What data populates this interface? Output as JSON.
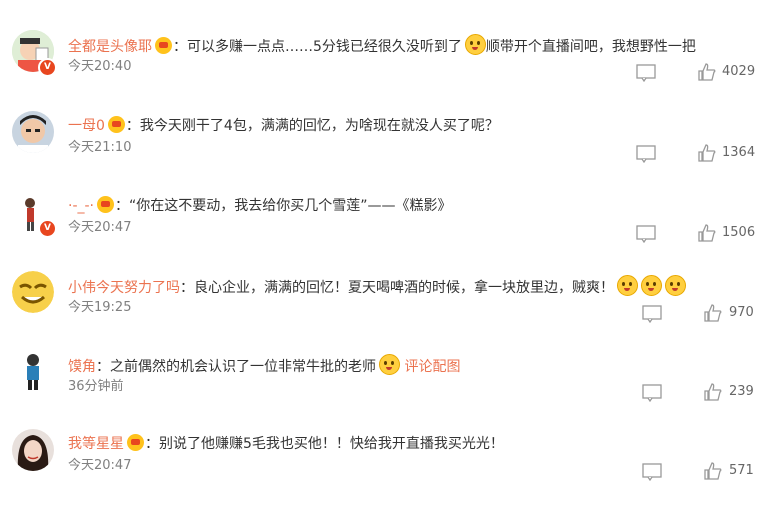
{
  "comments": [
    {
      "user": "全都是头像耶",
      "text": "：可以多赚一点点……5分钱已经很久没听到了",
      "text2": "顺带开个直播间吧，我想野性一把",
      "time": "今天20:40",
      "likes": "4029",
      "avatar_icon": "cartoon-avatar-icon"
    },
    {
      "user": "一母0",
      "text": "：我今天刚干了4包，满满的回忆，为啥现在就没人买了呢？",
      "time": "今天21:10",
      "likes": "1364",
      "avatar_icon": "person-avatar-icon"
    },
    {
      "user": "·-_-·",
      "text": "：“你在这不要动，我去给你买几个雪莲”——《糕影》",
      "time": "今天20:47",
      "likes": "1506",
      "avatar_icon": "figure-avatar-icon"
    },
    {
      "user": "小伟今天努力了吗",
      "text": "：良心企业，满满的回忆！夏天喝啤酒的时候，拿一块放里边，贼爽！",
      "time": "今天19:25",
      "likes": "970",
      "avatar_icon": "smile-avatar-icon"
    },
    {
      "user": "馍角",
      "text": "：之前偶然的机会认识了一位非常牛批的老师",
      "pic_link": "评论配图",
      "time": "36分钟前",
      "likes": "239",
      "avatar_icon": "standing-figure-avatar-icon"
    },
    {
      "user": "我等星星",
      "text": "：别说了他赚赚5毛我也买他！！快给我开直播我买光光！",
      "time": "今天20:47",
      "likes": "571",
      "avatar_icon": "girl-avatar-icon"
    }
  ],
  "colors": {
    "username": "#eb7350",
    "text": "#333333",
    "meta": "#808080"
  }
}
